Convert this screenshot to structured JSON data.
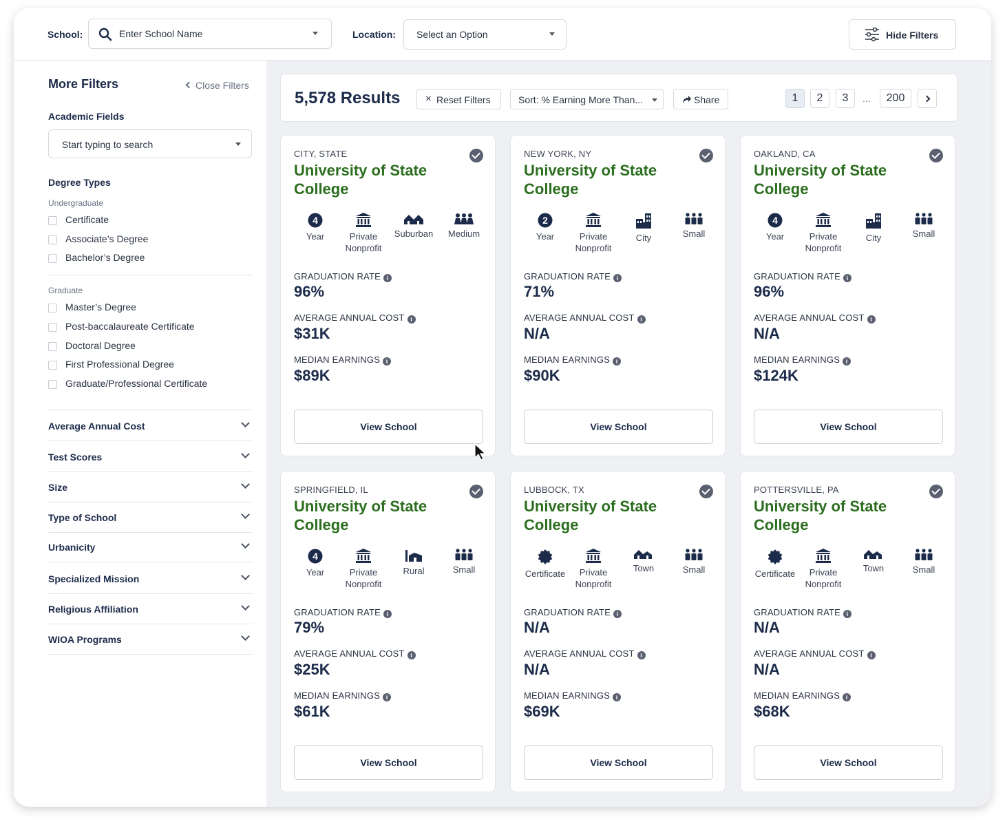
{
  "header": {
    "school_label": "School:",
    "school_placeholder": "Enter School Name",
    "location_label": "Location:",
    "location_placeholder": "Select an Option",
    "hide_filters": "Hide Filters"
  },
  "sidebar": {
    "title": "More Filters",
    "close": "Close Filters",
    "academic_fields": "Academic Fields",
    "academic_placeholder": "Start typing to search",
    "degree_types": "Degree Types",
    "undergraduate": "Undergraduate",
    "undergrad_options": [
      "Certificate",
      "Associate’s Degree",
      "Bachelor’s Degree"
    ],
    "graduate": "Graduate",
    "grad_options": [
      "Master’s Degree",
      "Post-baccalaureate Certificate",
      "Doctoral Degree",
      "First Professional Degree",
      "Graduate/Professional Certificate"
    ],
    "accordions": [
      "Average Annual Cost",
      "Test Scores",
      "Size",
      "Type of School",
      "Urbanicity",
      "Specialized Mission",
      "Religious Affiliation",
      "WIOA Programs"
    ]
  },
  "results": {
    "count": "5,578 Results",
    "reset": "Reset Filters",
    "sort": "Sort: % Earning More Than...",
    "share": "Share",
    "pages": [
      "1",
      "2",
      "3",
      "...",
      "200"
    ],
    "current_page": "1"
  },
  "labels": {
    "grad_rate": "GRADUATION RATE",
    "cost": "AVERAGE ANNUAL COST",
    "earnings": "MEDIAN EARNINGS",
    "view": "View School"
  },
  "colors": {
    "school_name": "#2c6e1f",
    "navy": "#1c2b4a",
    "background": "#eef0f3"
  },
  "cards": [
    {
      "location": "CITY, STATE",
      "name": "University of State College",
      "attrs": [
        {
          "icon": "four-year-icon",
          "label": "Year",
          "glyph": "4"
        },
        {
          "icon": "building-icon",
          "label": "Private Nonprofit"
        },
        {
          "icon": "suburban-icon",
          "label": "Suburban"
        },
        {
          "icon": "size-medium-icon",
          "label": "Medium"
        }
      ],
      "grad_rate": "96%",
      "cost": "$31K",
      "earnings": "$89K"
    },
    {
      "location": "NEW YORK, NY",
      "name": "University of State College",
      "attrs": [
        {
          "icon": "two-year-icon",
          "label": "Year",
          "glyph": "2"
        },
        {
          "icon": "building-icon",
          "label": "Private Nonprofit"
        },
        {
          "icon": "city-icon",
          "label": "City"
        },
        {
          "icon": "size-small-icon",
          "label": "Small"
        }
      ],
      "grad_rate": "71%",
      "cost": "N/A",
      "earnings": "$90K"
    },
    {
      "location": "OAKLAND, CA",
      "name": "University of State College",
      "attrs": [
        {
          "icon": "four-year-icon",
          "label": "Year",
          "glyph": "4"
        },
        {
          "icon": "building-icon",
          "label": "Private Nonprofit"
        },
        {
          "icon": "city-icon",
          "label": "City"
        },
        {
          "icon": "size-small-icon",
          "label": "Small"
        }
      ],
      "grad_rate": "96%",
      "cost": "N/A",
      "earnings": "$124K"
    },
    {
      "location": "SPRINGFIELD, IL",
      "name": "University of State College",
      "attrs": [
        {
          "icon": "four-year-icon",
          "label": "Year",
          "glyph": "4"
        },
        {
          "icon": "building-icon",
          "label": "Private Nonprofit"
        },
        {
          "icon": "rural-icon",
          "label": "Rural"
        },
        {
          "icon": "size-small-icon",
          "label": "Small"
        }
      ],
      "grad_rate": "79%",
      "cost": "$25K",
      "earnings": "$61K"
    },
    {
      "location": "LUBBOCK, TX",
      "name": "University of State College",
      "attrs": [
        {
          "icon": "certificate-icon",
          "label": "Certificate"
        },
        {
          "icon": "building-icon",
          "label": "Private Nonprofit"
        },
        {
          "icon": "town-icon",
          "label": "Town"
        },
        {
          "icon": "size-small-icon",
          "label": "Small"
        }
      ],
      "grad_rate": "N/A",
      "cost": "N/A",
      "earnings": "$69K"
    },
    {
      "location": "POTTERSVILLE, PA",
      "name": "University of State College",
      "attrs": [
        {
          "icon": "certificate-icon",
          "label": "Certificate"
        },
        {
          "icon": "building-icon",
          "label": "Private Nonprofit"
        },
        {
          "icon": "town-icon",
          "label": "Town"
        },
        {
          "icon": "size-small-icon",
          "label": "Small"
        }
      ],
      "grad_rate": "N/A",
      "cost": "N/A",
      "earnings": "$68K"
    }
  ]
}
